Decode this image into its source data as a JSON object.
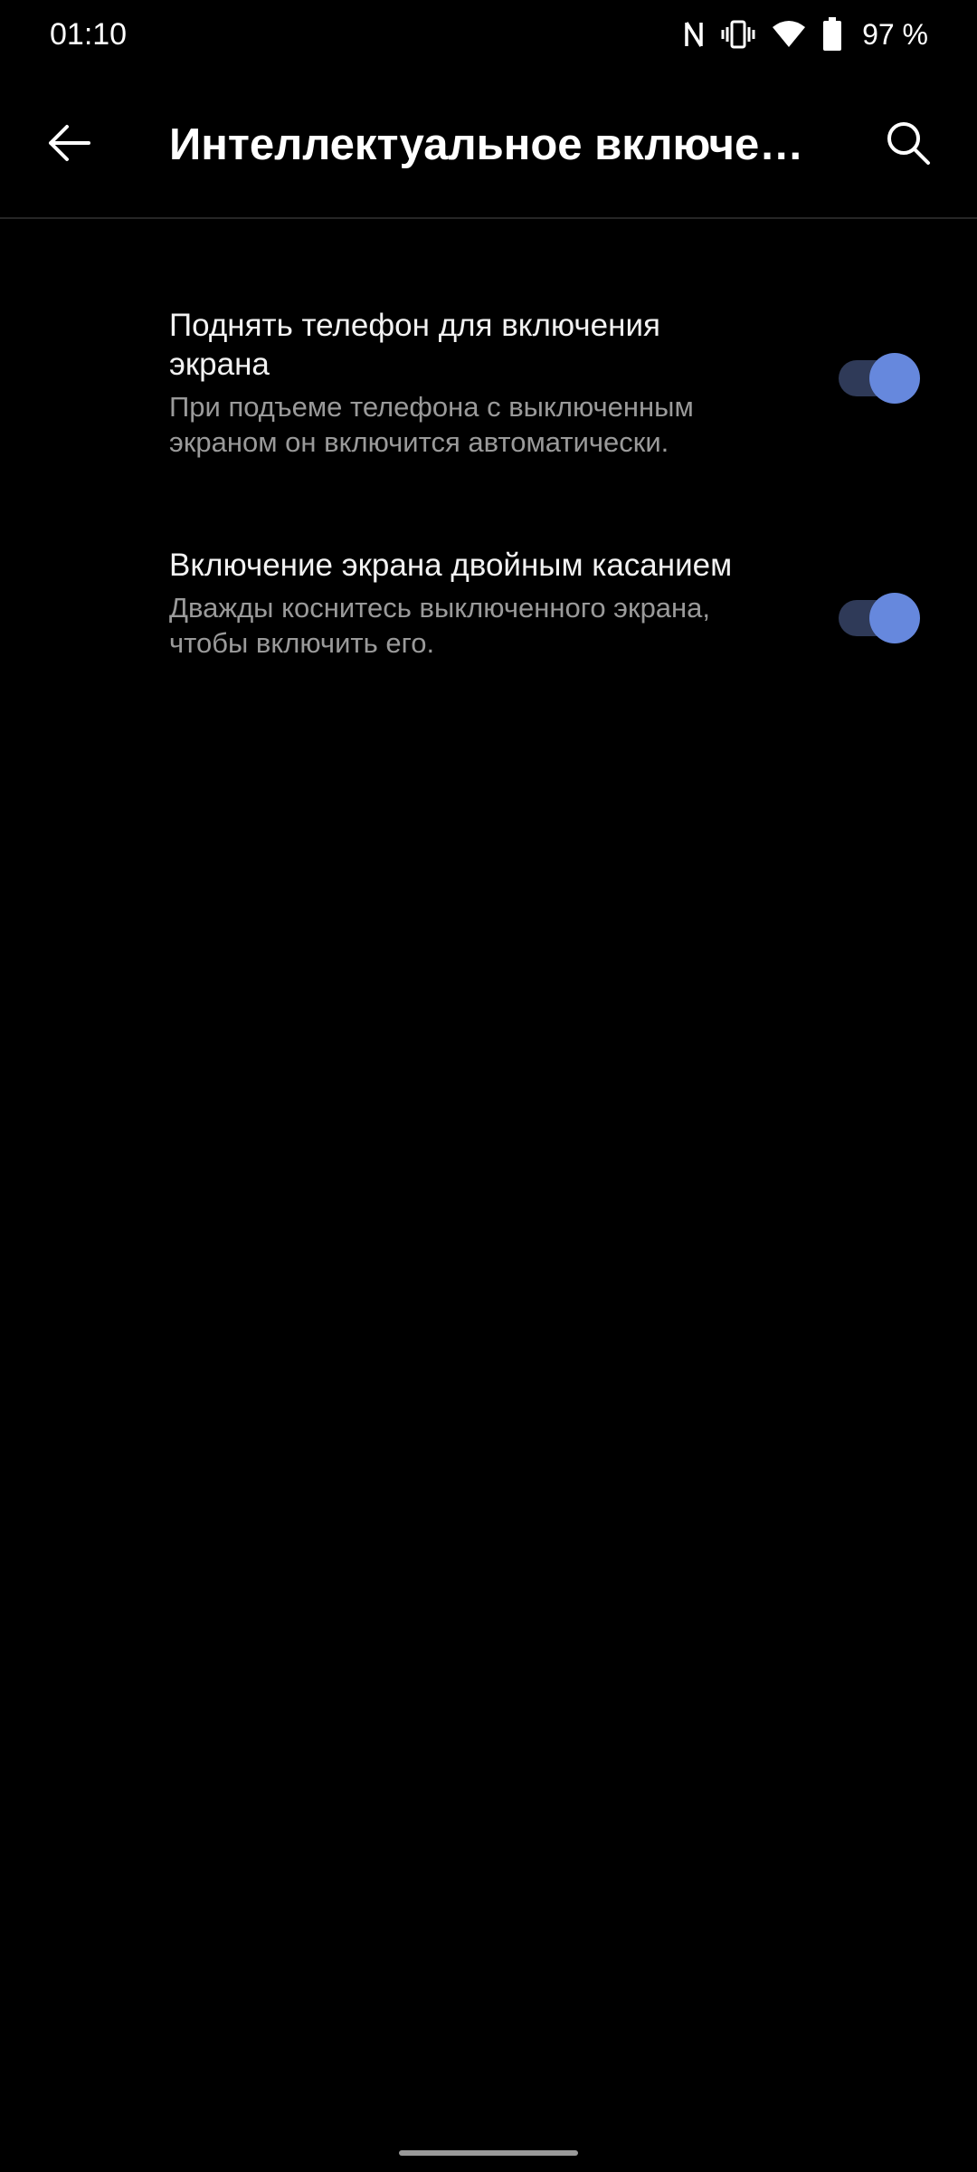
{
  "status_bar": {
    "time": "01:10",
    "battery": "97 %",
    "icons": [
      "nfc-icon",
      "vibrate-icon",
      "wifi-icon",
      "battery-icon"
    ]
  },
  "app_bar": {
    "title": "Интеллектуальное включени…",
    "icons": [
      "back-arrow-icon",
      "search-icon"
    ]
  },
  "settings": {
    "items": [
      {
        "title": "Поднять телефон для включения экрана",
        "summary": "При подъеме телефона с выключенным экраном он включится автоматически.",
        "enabled": true
      },
      {
        "title": "Включение экрана двойным касанием",
        "summary": "Дважды коснитесь выключенного экрана, чтобы включить его.",
        "enabled": true
      }
    ]
  },
  "colors": {
    "background": "#000000",
    "accent": "#6688dd",
    "toggle_track_on": "#2f3a58",
    "summary_text": "#9a9a9a"
  }
}
